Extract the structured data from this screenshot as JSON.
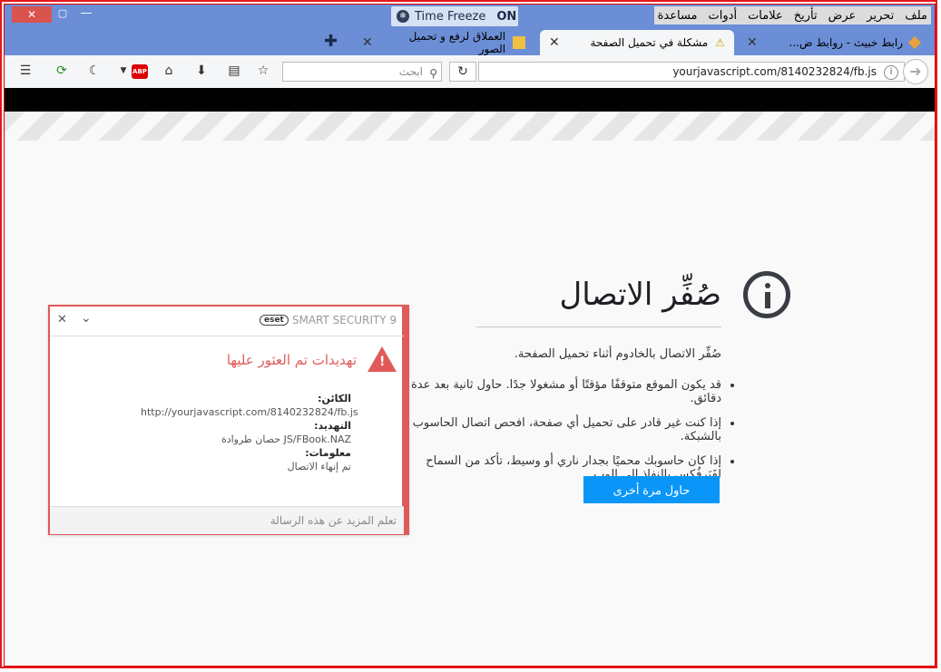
{
  "window": {
    "close": "✕",
    "restore": "▢",
    "minimize": "—"
  },
  "timefreeze": {
    "label": "Time Freeze",
    "state": "ON"
  },
  "menubar": {
    "items": [
      "ملف",
      "تحرير",
      "عرض",
      "تأريخ",
      "علامات",
      "أدوات",
      "مساعدة"
    ]
  },
  "tabs": [
    {
      "label": "رابط خبيث - روابط ض..."
    },
    {
      "label": "مشكلة في تحميل الصفحة"
    },
    {
      "label": "العملاق لرفع و تحميل الصور"
    }
  ],
  "toolbar": {
    "search_placeholder": "ابحث",
    "url": "yourjavascript.com/8140232824/fb.js",
    "abp_label": "ABP"
  },
  "error": {
    "title": "صُفِّر الاتصال",
    "description": "صُفِّر الاتصال بالخادوم أثناء تحميل الصفحة.",
    "bullets": [
      "قد يكون الموقع متوقفًا مؤقتًا أو مشغولا جدًا. حاول ثانية بعد عدة دقائق.",
      "إذا كنت غير قادر على تحميل أي صفحة، افحص اتصال الحاسوب بالشبكة.",
      "إذا كان حاسوبك محميًا بجدار ناري أو وسيط، تأكد من السماح لفَيَرفُكس بالنفاذ إلى الوِب."
    ],
    "retry": "حاول مرة أخرى"
  },
  "eset": {
    "logo": "eset",
    "product": "SMART SECURITY 9",
    "title": "تهديدات تم العثور عليها",
    "object_label": "الكائن:",
    "object_value": "http://yourjavascript.com/8140232824/fb.js",
    "threat_label": "التهديد:",
    "threat_value": "JS/FBook.NAZ حصان طروادة",
    "info_label": "معلومات:",
    "info_value": "تم إنهاء الاتصال",
    "learn_more": "تعلم المزيد عن هذه الرسالة"
  },
  "colors": {
    "titlebar": "#6b8ed6",
    "eset_red": "#e05a5a",
    "retry_blue": "#0996f8"
  }
}
